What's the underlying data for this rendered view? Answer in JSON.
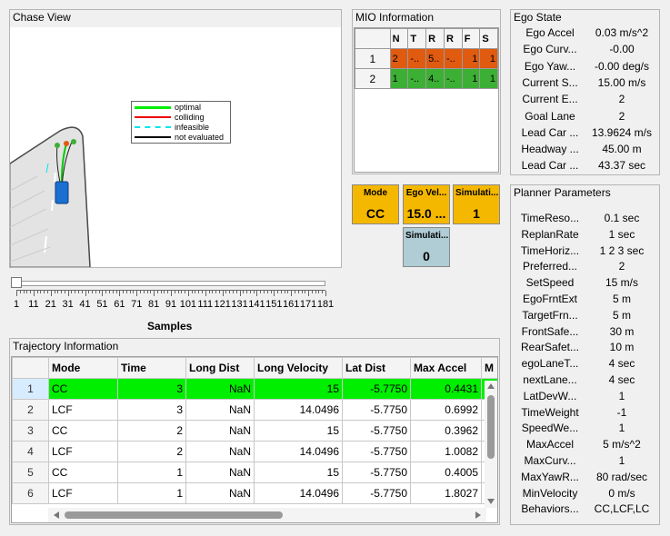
{
  "chase_view": {
    "title": "Chase View"
  },
  "legend": {
    "items": [
      {
        "label": "optimal",
        "color": "#00ee00"
      },
      {
        "label": "colliding",
        "color": "#ee0000"
      },
      {
        "label": "infeasible",
        "color": "#00e5ee"
      },
      {
        "label": "not evaluated",
        "color": "#000000"
      }
    ]
  },
  "slider": {
    "ticks": [
      "1",
      "11",
      "21",
      "31",
      "41",
      "51",
      "61",
      "71",
      "81",
      "91",
      "101",
      "111",
      "121",
      "131",
      "141",
      "151",
      "161",
      "171",
      "181"
    ],
    "label": "Samples",
    "value": 1
  },
  "mio": {
    "title": "MIO Information",
    "headers": [
      "N",
      "T",
      "R",
      "R",
      "F",
      "S"
    ],
    "rows": [
      {
        "id": "1",
        "cells": [
          "2",
          "-..",
          "5..",
          "-..",
          "1",
          "1"
        ],
        "color": "#e05a10"
      },
      {
        "id": "2",
        "cells": [
          "1",
          "-..",
          "4..",
          "-..",
          "1",
          "1"
        ],
        "color": "#3cb034"
      }
    ]
  },
  "cards": {
    "mode": {
      "title": "Mode",
      "value": "CC"
    },
    "ego_velocity": {
      "title": "Ego Vel...",
      "value": "15.0 ..."
    },
    "simulation1": {
      "title": "Simulati...",
      "value": "1"
    },
    "simulation2": {
      "title": "Simulati...",
      "value": "0"
    }
  },
  "ego_state": {
    "title": "Ego State",
    "items": [
      {
        "key": "Ego Accel",
        "value": "0.03 m/s^2"
      },
      {
        "key": "Ego Curv...",
        "value": "-0.00"
      },
      {
        "key": "Ego Yaw...",
        "value": "-0.00 deg/s"
      },
      {
        "key": "Current S...",
        "value": "15.00 m/s"
      },
      {
        "key": "Current E...",
        "value": "2"
      },
      {
        "key": "Goal Lane",
        "value": "2"
      },
      {
        "key": "Lead Car ...",
        "value": "13.9624 m/s"
      },
      {
        "key": "Headway ...",
        "value": "45.00 m"
      },
      {
        "key": "Lead Car ...",
        "value": "43.37 sec"
      }
    ]
  },
  "planner": {
    "title": "Planner  Parameters",
    "items": [
      {
        "key": "TimeReso...",
        "value": "0.1 sec"
      },
      {
        "key": "ReplanRate",
        "value": "1 sec"
      },
      {
        "key": "TimeHoriz...",
        "value": "1  2  3 sec"
      },
      {
        "key": "Preferred...",
        "value": "2"
      },
      {
        "key": "SetSpeed",
        "value": "15 m/s"
      },
      {
        "key": "EgoFrntExt",
        "value": "5 m"
      },
      {
        "key": "TargetFrn...",
        "value": "5 m"
      },
      {
        "key": "FrontSafe...",
        "value": "30 m"
      },
      {
        "key": "RearSafet...",
        "value": "10 m"
      },
      {
        "key": "egoLaneT...",
        "value": "4 sec"
      },
      {
        "key": "nextLane...",
        "value": "4 sec"
      },
      {
        "key": "LatDevW...",
        "value": "1"
      },
      {
        "key": "TimeWeight",
        "value": "-1"
      },
      {
        "key": "SpeedWe...",
        "value": "1"
      },
      {
        "key": "MaxAccel",
        "value": "5 m/s^2"
      },
      {
        "key": "MaxCurv...",
        "value": "1"
      },
      {
        "key": "MaxYawR...",
        "value": "80 rad/sec"
      },
      {
        "key": "MinVelocity",
        "value": "0 m/s"
      },
      {
        "key": "Behaviors...",
        "value": "CC,LCF,LC"
      }
    ]
  },
  "trajectory": {
    "title": "Trajectory Information",
    "headers": [
      "Mode",
      "Time",
      "Long Dist",
      "Long Velocity",
      "Lat Dist",
      "Max Accel",
      "M"
    ],
    "rows": [
      {
        "id": "1",
        "cells": [
          "CC",
          "3",
          "NaN",
          "15",
          "-5.7750",
          "0.4431"
        ]
      },
      {
        "id": "2",
        "cells": [
          "LCF",
          "3",
          "NaN",
          "14.0496",
          "-5.7750",
          "0.6992"
        ]
      },
      {
        "id": "3",
        "cells": [
          "CC",
          "2",
          "NaN",
          "15",
          "-5.7750",
          "0.3962"
        ]
      },
      {
        "id": "4",
        "cells": [
          "LCF",
          "2",
          "NaN",
          "14.0496",
          "-5.7750",
          "1.0082"
        ]
      },
      {
        "id": "5",
        "cells": [
          "CC",
          "1",
          "NaN",
          "15",
          "-5.7750",
          "0.4005"
        ]
      },
      {
        "id": "6",
        "cells": [
          "LCF",
          "1",
          "NaN",
          "14.0496",
          "-5.7750",
          "1.8027"
        ]
      }
    ],
    "selected_row": 1
  }
}
